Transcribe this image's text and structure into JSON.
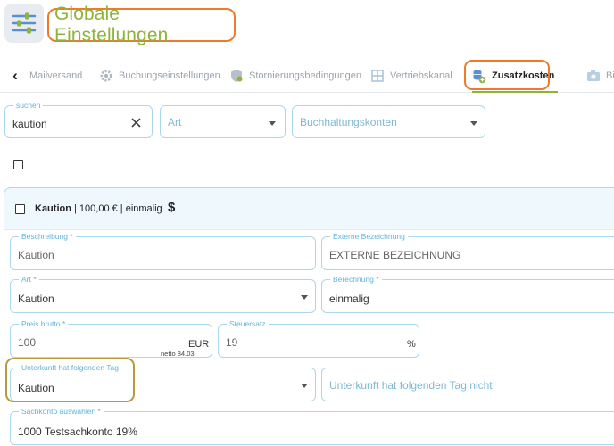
{
  "header": {
    "title": "Globale Einstellungen",
    "app_icon": "sliders-icon"
  },
  "tabs": [
    {
      "label": "Mailversand",
      "icon": "mail-icon"
    },
    {
      "label": "Buchungseinstellungen",
      "icon": "gear-icon"
    },
    {
      "label": "Stornierungsbedingungen",
      "icon": "shield-icon"
    },
    {
      "label": "Vertriebskanal",
      "icon": "grid-icon"
    },
    {
      "label": "Zusatzkosten",
      "icon": "coins-plus-icon",
      "active": true
    },
    {
      "label": "Bi",
      "icon": "camera-icon"
    }
  ],
  "filters": {
    "search_label": "suchen",
    "search_value": "kaution",
    "art_placeholder": "Art",
    "buchhaltung_placeholder": "Buchhaltungskonten"
  },
  "card": {
    "name": "Kaution",
    "summary": " | 100,00 € | einmalig",
    "icon": "dollar-icon",
    "fields": {
      "beschreibung_label": "Beschreibung *",
      "beschreibung_value": "Kaution",
      "externe_label": "Externe Bezeichnung",
      "externe_value": "EXTERNE BEZEICHNUNG",
      "art_label": "Art *",
      "art_value": "Kaution",
      "berechnung_label": "Berechnung *",
      "berechnung_value": "einmalig",
      "preis_label": "Preis brutto *",
      "preis_value": "100",
      "preis_unit": "EUR",
      "preis_netto": "netto 84.03",
      "steuer_label": "Steuersatz",
      "steuer_value": "19",
      "steuer_unit": "%",
      "tag_label": "Unterkunft hat folgenden Tag",
      "tag_value": "Kaution",
      "tag_not_placeholder": "Unterkunft hat folgenden Tag nicht",
      "sachkonto_label": "Sachkonto auswählen *",
      "sachkonto_value": "1000 Testsachkonto 19%"
    }
  },
  "colors": {
    "accent_blue": "#61b4da",
    "highlight_orange": "#ef7a2a",
    "title_green": "#8fb33a",
    "highlight_olive": "#b79a3a"
  }
}
